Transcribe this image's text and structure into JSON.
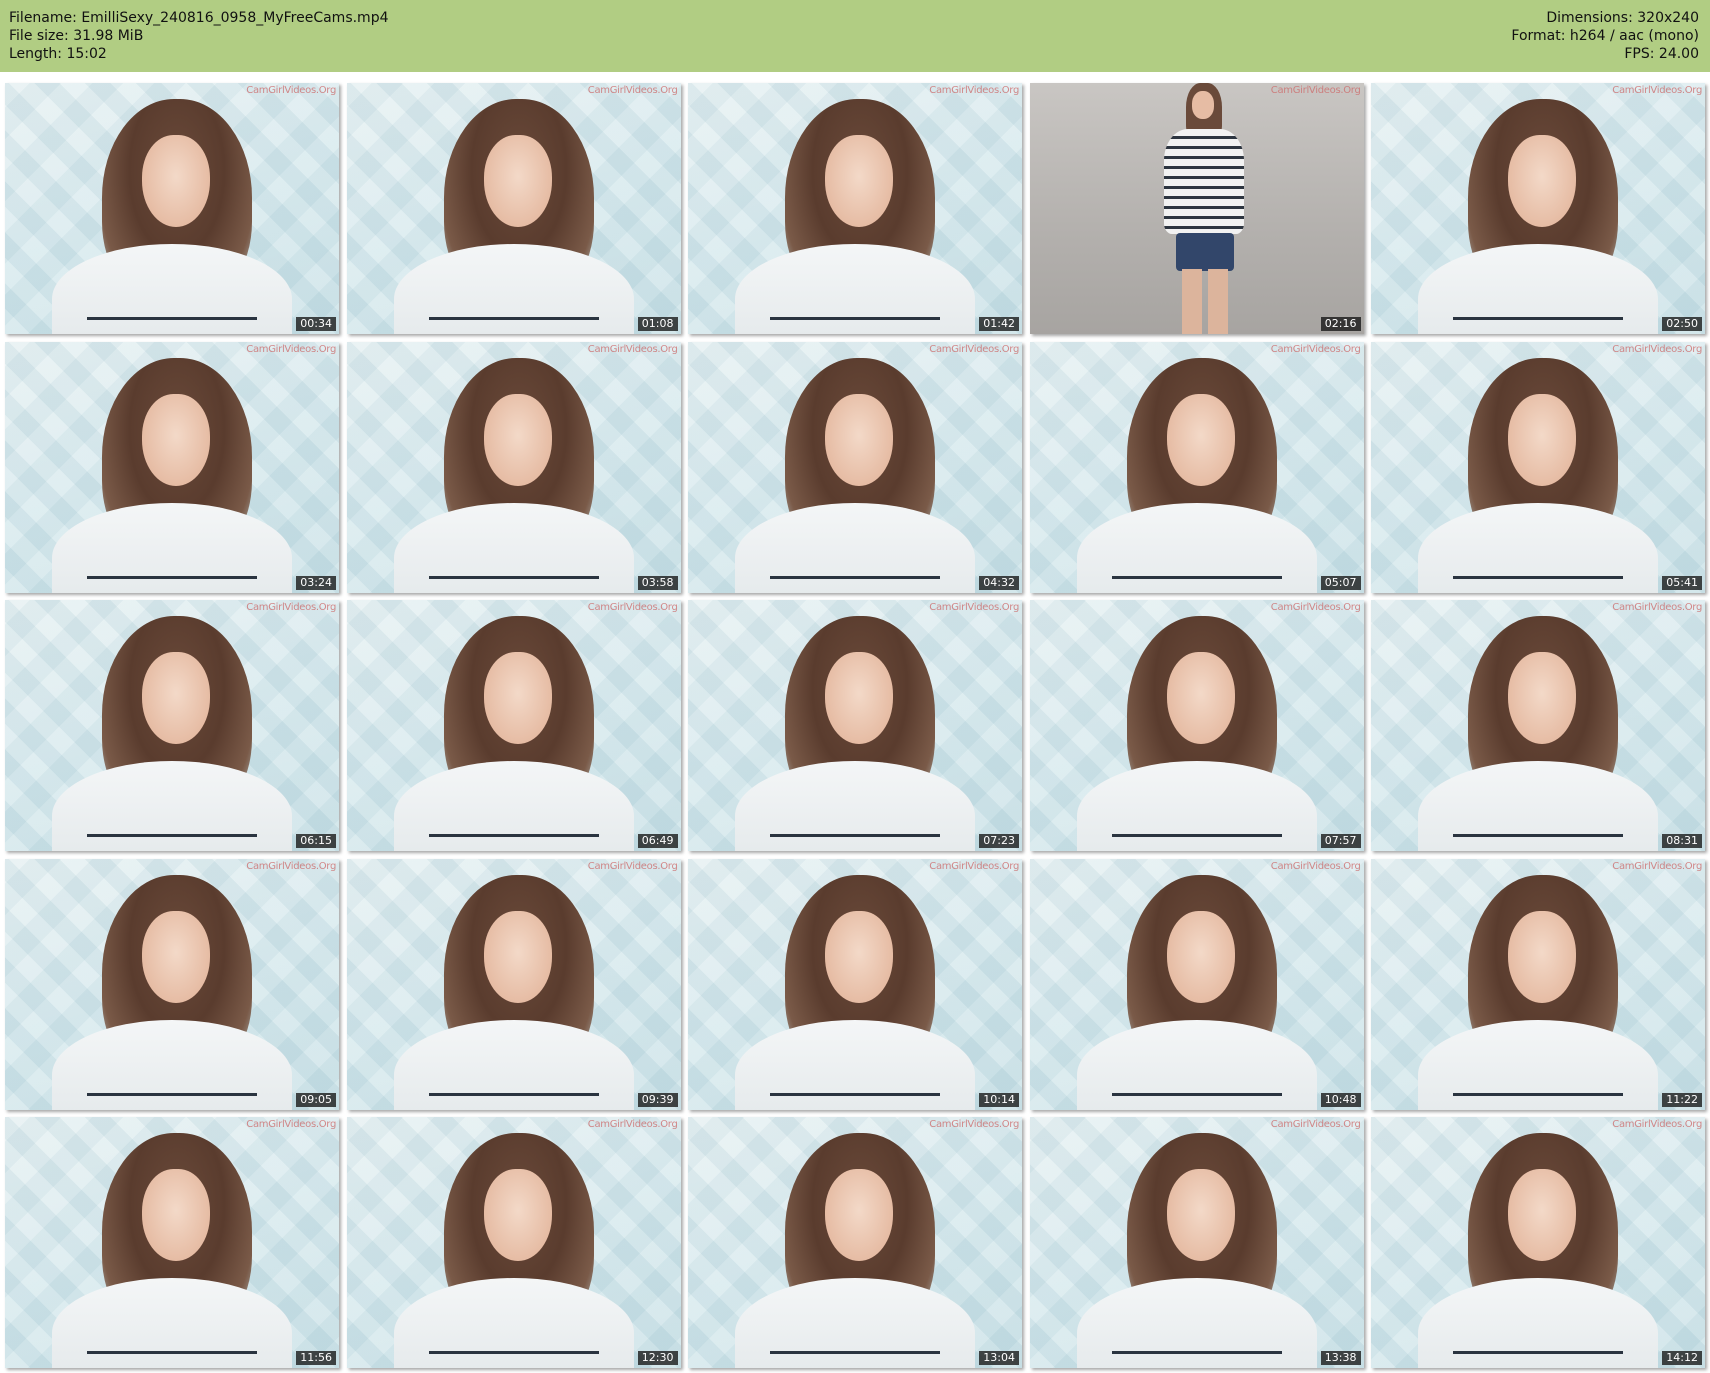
{
  "header": {
    "left": [
      {
        "label": "Filename:",
        "value": "EmilliSexy_240816_0958_MyFreeCams.mp4"
      },
      {
        "label": "File size:",
        "value": "31.98 MiB"
      },
      {
        "label": "Length:",
        "value": "15:02"
      }
    ],
    "right": [
      {
        "label": "Dimensions:",
        "value": "320x240"
      },
      {
        "label": "Format:",
        "value": "h264 / aac (mono)"
      },
      {
        "label": "FPS:",
        "value": "24.00"
      }
    ]
  },
  "watermark": "CamGirlVideos.Org",
  "colors": {
    "header_bg": "#b1cd83"
  },
  "thumbnails": [
    {
      "time": "00:34"
    },
    {
      "time": "01:08"
    },
    {
      "time": "01:42"
    },
    {
      "time": "02:16",
      "variant": "full-body"
    },
    {
      "time": "02:50"
    },
    {
      "time": "03:24"
    },
    {
      "time": "03:58"
    },
    {
      "time": "04:32"
    },
    {
      "time": "05:07"
    },
    {
      "time": "05:41"
    },
    {
      "time": "06:15"
    },
    {
      "time": "06:49"
    },
    {
      "time": "07:23"
    },
    {
      "time": "07:57"
    },
    {
      "time": "08:31"
    },
    {
      "time": "09:05"
    },
    {
      "time": "09:39"
    },
    {
      "time": "10:14"
    },
    {
      "time": "10:48"
    },
    {
      "time": "11:22"
    },
    {
      "time": "11:56"
    },
    {
      "time": "12:30"
    },
    {
      "time": "13:04"
    },
    {
      "time": "13:38"
    },
    {
      "time": "14:12"
    }
  ]
}
